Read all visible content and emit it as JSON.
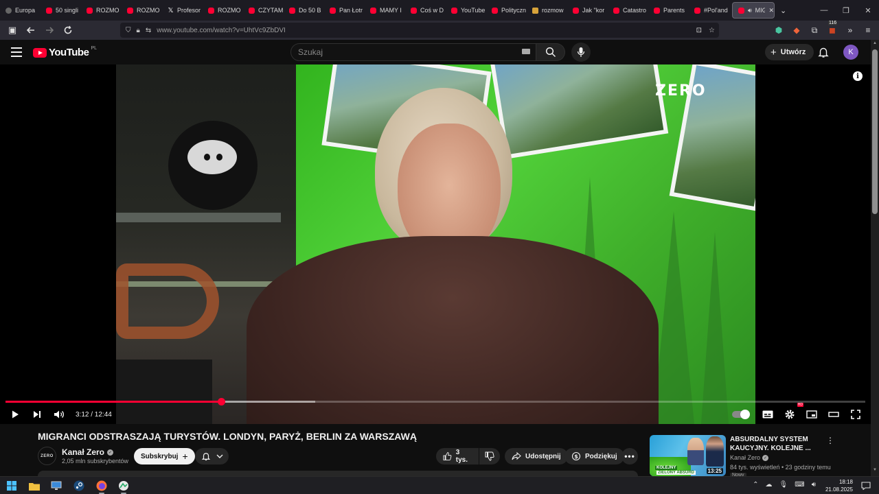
{
  "browser": {
    "tabs": [
      {
        "label": "Europa",
        "favicon": "globe-icon"
      },
      {
        "label": "50 singli",
        "favicon": "youtube-icon"
      },
      {
        "label": "ROZMO",
        "favicon": "youtube-icon"
      },
      {
        "label": "ROZMO",
        "favicon": "youtube-icon"
      },
      {
        "label": "Profesor",
        "favicon": "x-icon"
      },
      {
        "label": "ROZMO",
        "favicon": "youtube-icon"
      },
      {
        "label": "CZYTAM",
        "favicon": "youtube-icon"
      },
      {
        "label": "Do 50 B",
        "favicon": "youtube-icon"
      },
      {
        "label": "Pan Łotr",
        "favicon": "youtube-icon"
      },
      {
        "label": "MAMY I",
        "favicon": "youtube-icon"
      },
      {
        "label": "Coś w D",
        "favicon": "youtube-icon"
      },
      {
        "label": "YouTube",
        "favicon": "youtube-icon"
      },
      {
        "label": "Polityczn",
        "favicon": "youtube-icon"
      },
      {
        "label": "rozmow",
        "favicon": "jp-icon"
      },
      {
        "label": "Jak \"kor",
        "favicon": "youtube-icon"
      },
      {
        "label": "Catastro",
        "favicon": "youtube-icon"
      },
      {
        "label": "Parents",
        "favicon": "youtube-icon"
      },
      {
        "label": "#Pol'and",
        "favicon": "youtube-icon"
      }
    ],
    "active_tab": {
      "label": "MIG",
      "favicon": "youtube-icon"
    },
    "url": "www.youtube.com/watch?v=UhtVc9ZbDVI",
    "extensions_badge": "116"
  },
  "youtube": {
    "logo_text": "YouTube",
    "country_code": "PL",
    "search_placeholder": "Szukaj",
    "create_label": "Utwórz",
    "avatar_letter": "K",
    "accent": "#ff0033"
  },
  "player": {
    "current_time": "3:12",
    "duration": "12:44",
    "time_display": "3:12 / 12:44",
    "played_fraction": 0.251,
    "buffered_fraction": 0.36,
    "overlay_logo": "ZERO",
    "hd_badge": "HD"
  },
  "video": {
    "title": "MIGRANCI ODSTRASZAJĄ TURYSTÓW. LONDYN, PARYŻ, BERLIN ZA WARSZAWĄ",
    "channel": {
      "name": "Kanał Zero",
      "avatar_text": "ZERO",
      "subscribers": "2,05 mln subskrybentów"
    },
    "subscribe_label": "Subskrybuj",
    "likes": "3 tys.",
    "share_label": "Udostępnij",
    "thanks_label": "Podziękuj"
  },
  "recommendation": {
    "title": "ABSURDALNY SYSTEM KAUCYJNY. KOLEJNE ...",
    "channel": "Kanał Zero",
    "meta": "84 tys. wyświetleń • 23 godziny temu",
    "badge": "Nowy",
    "duration": "13:25",
    "thumb_text_1": "KOLEJNY",
    "thumb_text_2": "ZIELONY ABSURD"
  },
  "taskbar": {
    "time": "18:18",
    "date": "21.08.2025"
  }
}
